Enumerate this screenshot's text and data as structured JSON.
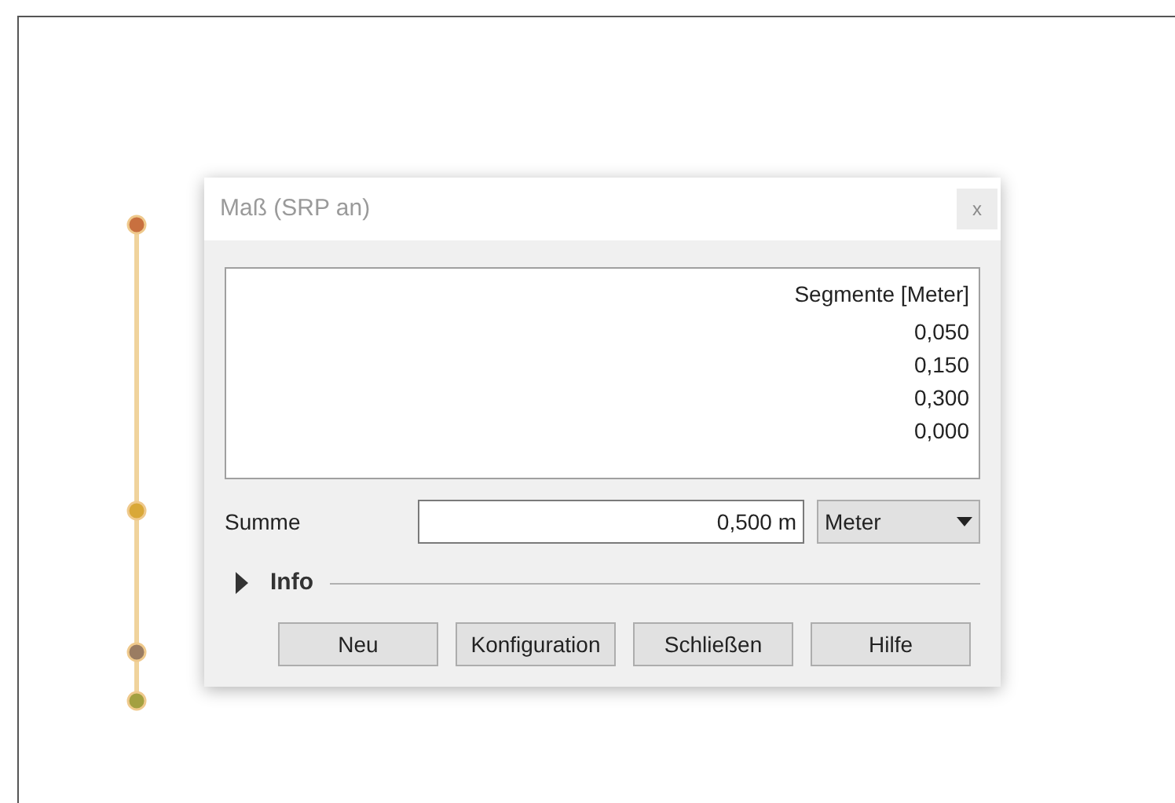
{
  "dialog": {
    "title": "Maß (SRP an)",
    "close": "x"
  },
  "segments": {
    "header": "Segmente [Meter]",
    "values": [
      "0,050",
      "0,150",
      "0,300",
      "0,000"
    ]
  },
  "sum": {
    "label": "Summe",
    "value": "0,500 m",
    "unit": "Meter"
  },
  "info": {
    "label": "Info",
    "expanded": false
  },
  "buttons": [
    "Neu",
    "Konfiguration",
    "Schließen",
    "Hilfe"
  ]
}
